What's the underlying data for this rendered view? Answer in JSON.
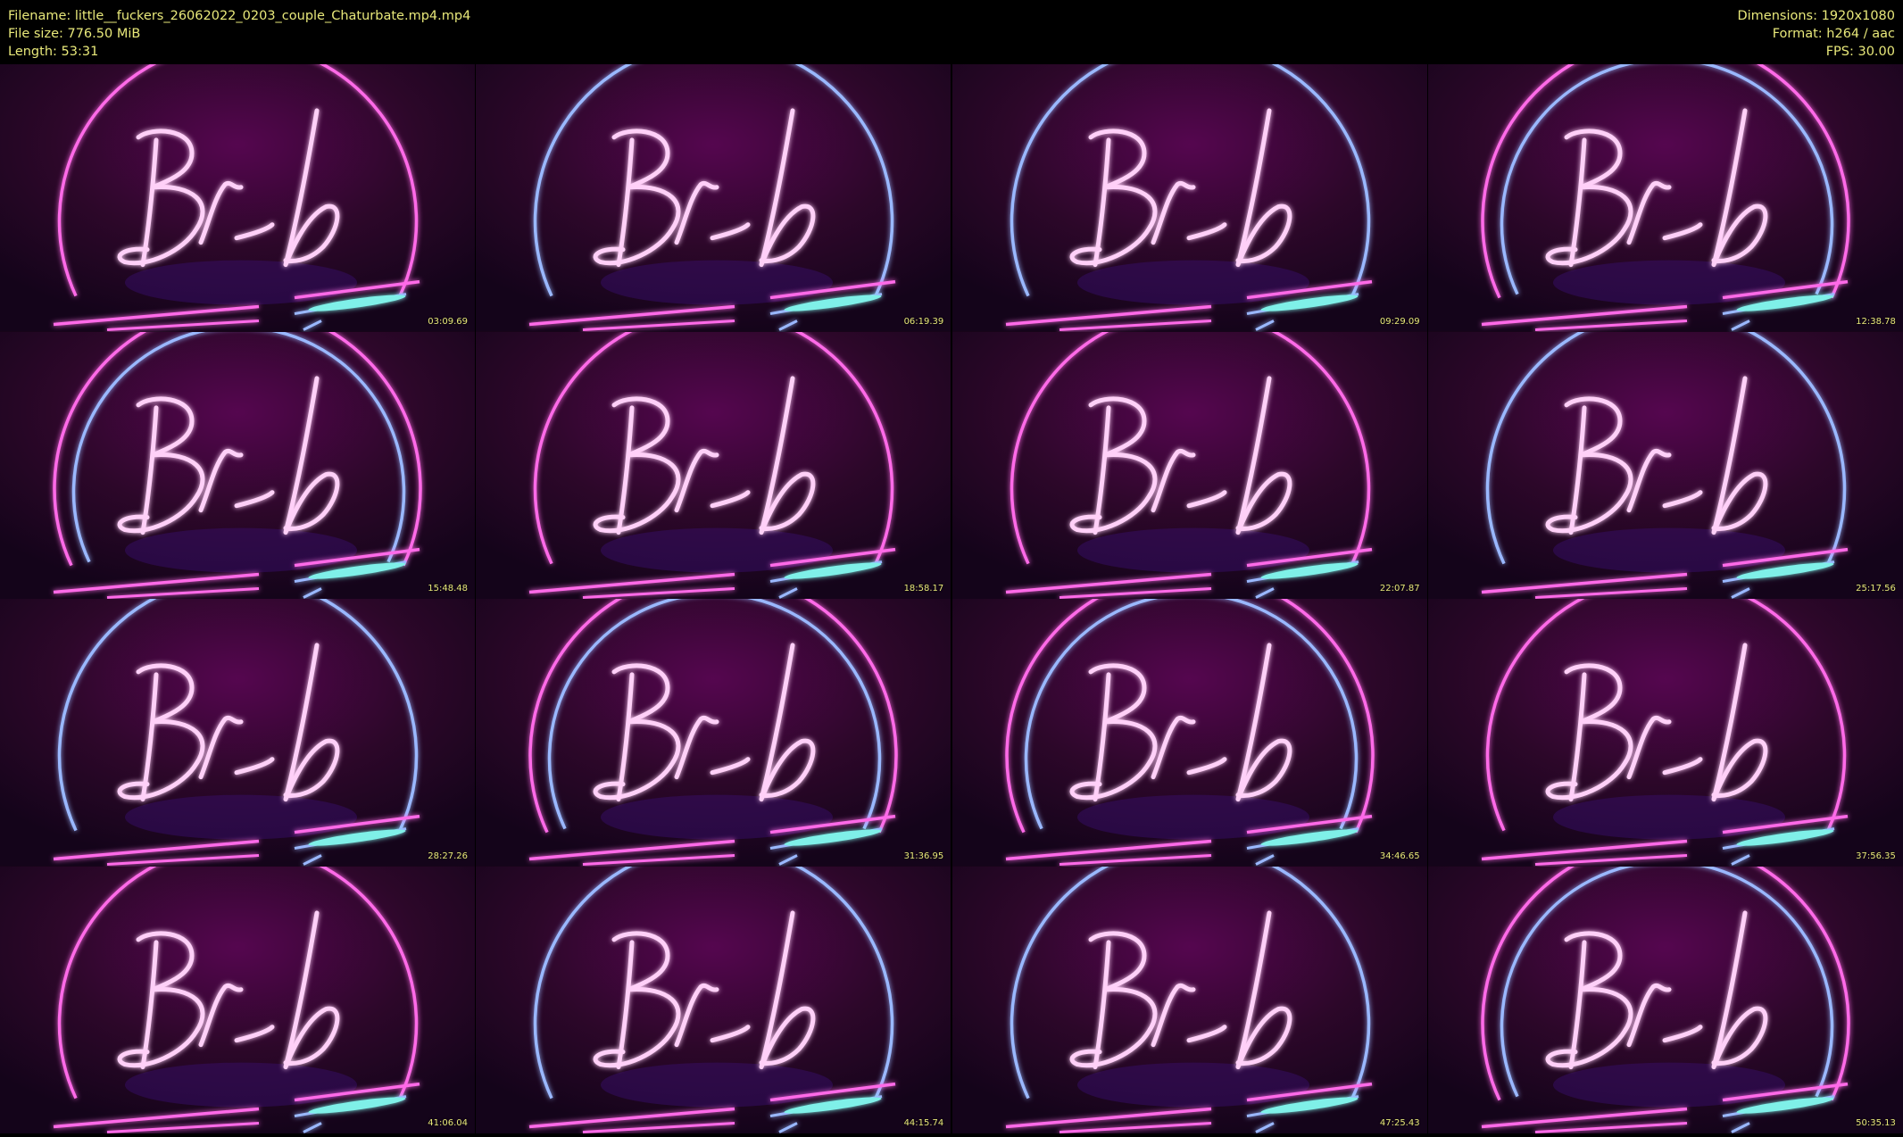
{
  "header": {
    "filename": "Filename: little__fuckers_26062022_0203_couple_Chaturbate.mp4.mp4",
    "file_size": "File size: 776.50 MiB",
    "length": "Length: 53:31",
    "dimensions": "Dimensions: 1920x1080",
    "format": "Format: h264 / aac",
    "fps": "FPS: 30.00"
  },
  "thumbnails": [
    {
      "timestamp": "03:09.69",
      "arcs": [
        "pink"
      ]
    },
    {
      "timestamp": "06:19.39",
      "arcs": [
        "blue"
      ]
    },
    {
      "timestamp": "09:29.09",
      "arcs": [
        "blue"
      ]
    },
    {
      "timestamp": "12:38.78",
      "arcs": [
        "pink",
        "blue"
      ]
    },
    {
      "timestamp": "15:48.48",
      "arcs": [
        "pink",
        "blue"
      ]
    },
    {
      "timestamp": "18:58.17",
      "arcs": [
        "pink"
      ]
    },
    {
      "timestamp": "22:07.87",
      "arcs": [
        "pink"
      ]
    },
    {
      "timestamp": "25:17.56",
      "arcs": [
        "blue"
      ]
    },
    {
      "timestamp": "28:27.26",
      "arcs": [
        "blue"
      ]
    },
    {
      "timestamp": "31:36.95",
      "arcs": [
        "pink",
        "blue"
      ]
    },
    {
      "timestamp": "34:46.65",
      "arcs": [
        "pink",
        "blue"
      ]
    },
    {
      "timestamp": "37:56.35",
      "arcs": [
        "pink"
      ]
    },
    {
      "timestamp": "41:06.04",
      "arcs": [
        "pink"
      ]
    },
    {
      "timestamp": "44:15.74",
      "arcs": [
        "blue"
      ]
    },
    {
      "timestamp": "47:25.43",
      "arcs": [
        "blue"
      ]
    },
    {
      "timestamp": "50:35.13",
      "arcs": [
        "pink",
        "blue"
      ]
    }
  ],
  "colors": {
    "text": "#e8e87a",
    "pink_neon": "#ff6be8",
    "blue_neon": "#9ab8ff",
    "teal_neon": "#7ff0e8",
    "background": "#1a0518"
  }
}
